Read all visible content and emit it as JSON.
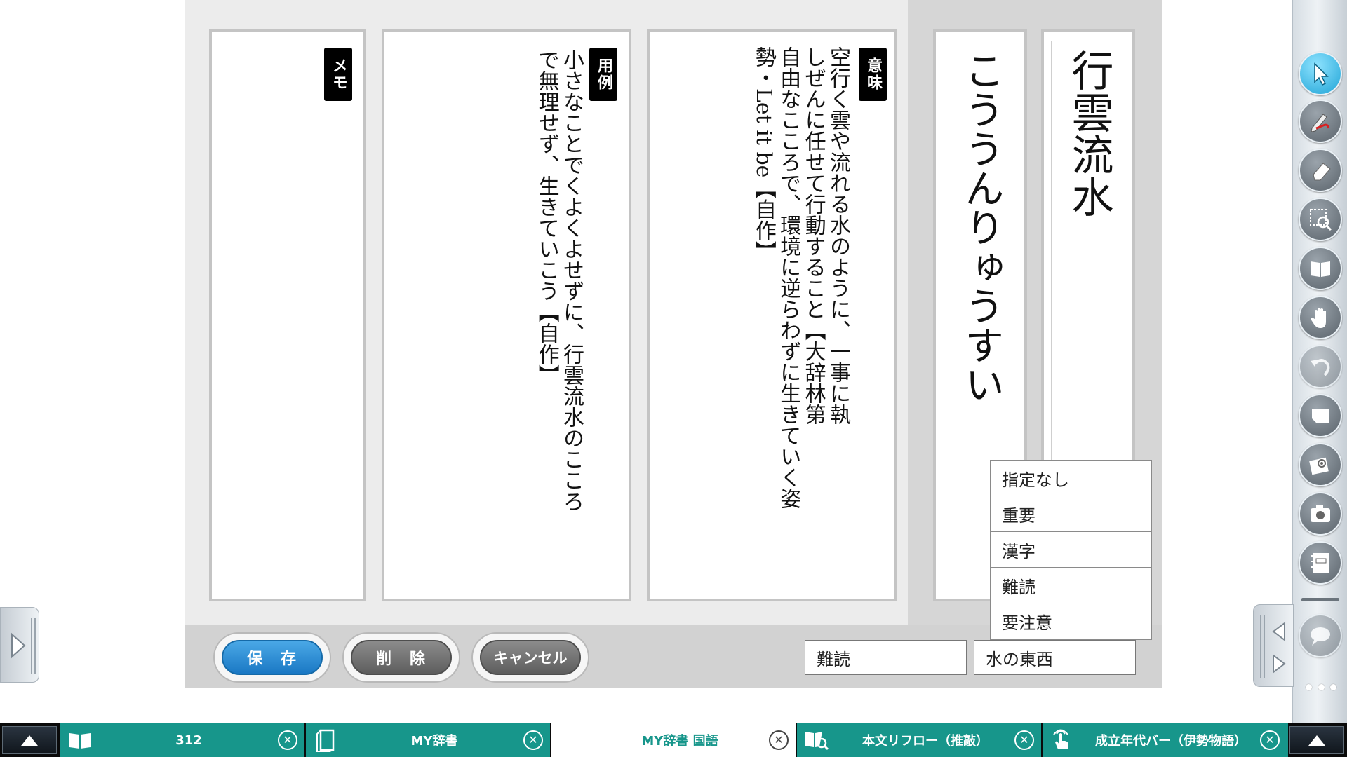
{
  "card": {
    "kanji": "行雲流水",
    "reading": "こううんりゅうすい",
    "meaning_label": "意味",
    "meaning_text": "空行く雲や流れる水のように、一事に執\nしぜんに任せて行動すること【大辞林第\n自由なこころで、環境に逆らわずに生きていく姿\n勢・Let it be【自作】",
    "example_label": "用例",
    "example_text": "小さなことでくよくよせずに、行雲流水のこころ\nで無理せず、生きていこう【自作】",
    "memo_label": "メモ",
    "memo_text": ""
  },
  "buttons": {
    "save": "保　存",
    "delete": "削　除",
    "cancel": "キャンセル"
  },
  "tag": {
    "options": [
      "指定なし",
      "重要",
      "漢字",
      "難読",
      "要注意"
    ],
    "selected": "難読",
    "category": "水の東西"
  },
  "toolbar": {
    "tools": [
      "pointer-icon",
      "pen-icon",
      "eraser-icon",
      "zoom-select-icon",
      "book-icon",
      "hand-icon",
      "undo-icon",
      "card-icon",
      "flower-icon",
      "camera-icon",
      "notebook-icon"
    ],
    "extra": [
      "speech-bubble-icon",
      "more-icon"
    ],
    "accent": "#1fa4d6"
  },
  "taskbar": {
    "tabs": [
      {
        "label": "312",
        "icon": "book-icon"
      },
      {
        "label": "MY辞書",
        "icon": "notebook-icon"
      },
      {
        "label": "MY辞書 国語",
        "icon": ""
      },
      {
        "label": "本文リフロー（推敲）",
        "icon": "book-search-icon"
      },
      {
        "label": "成立年代バー（伊勢物語）",
        "icon": "touch-icon"
      }
    ],
    "color": "#17968b"
  }
}
